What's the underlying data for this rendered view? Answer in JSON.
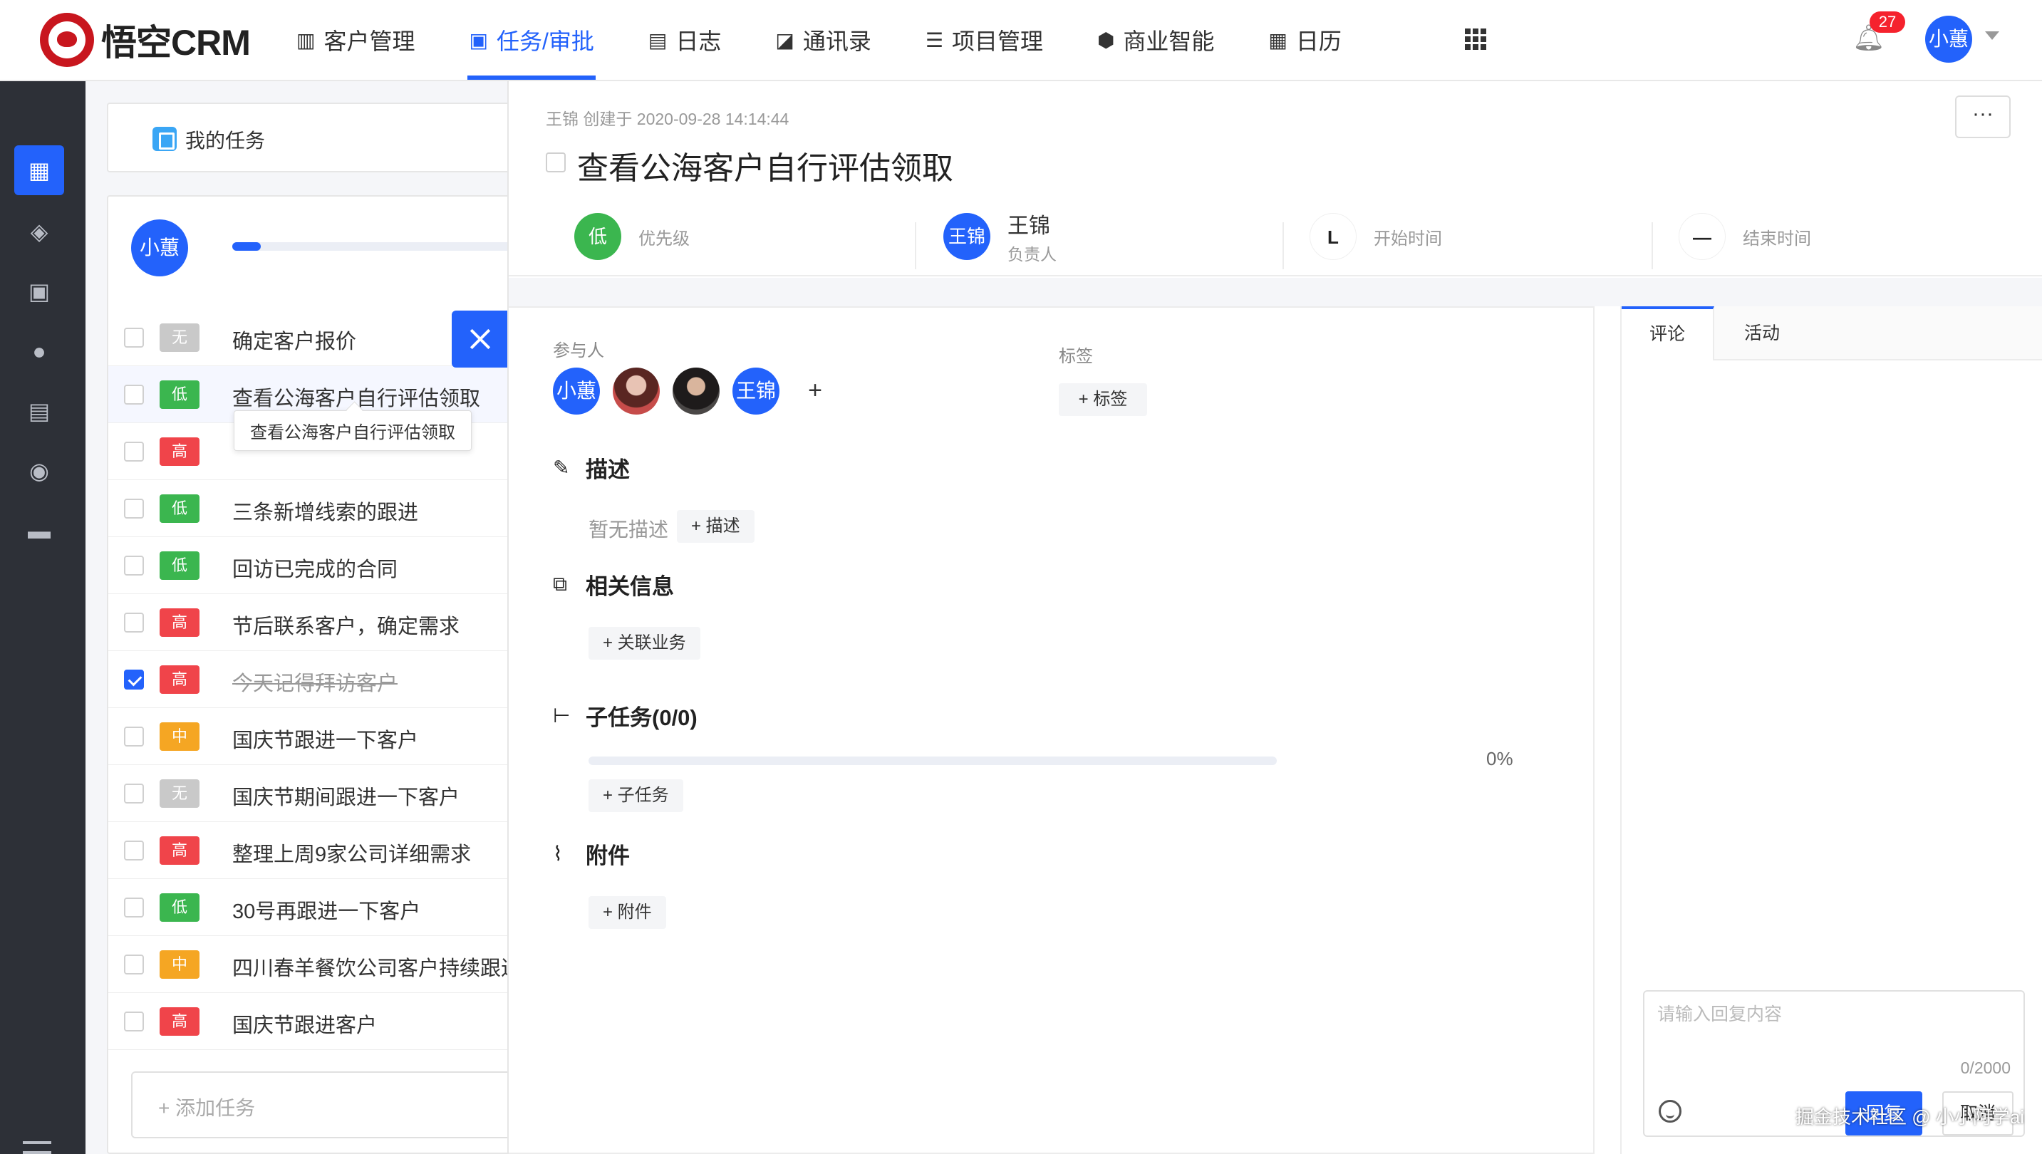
{
  "app": {
    "logo_text": "悟空CRM"
  },
  "nav": [
    {
      "label": "客户管理",
      "icon": "building-icon"
    },
    {
      "label": "任务/审批",
      "icon": "briefcase-icon"
    },
    {
      "label": "日志",
      "icon": "journal-icon"
    },
    {
      "label": "通讯录",
      "icon": "address-book-icon"
    },
    {
      "label": "项目管理",
      "icon": "list-icon"
    },
    {
      "label": "商业智能",
      "icon": "shield-check-icon"
    },
    {
      "label": "日历",
      "icon": "calendar-icon"
    }
  ],
  "header": {
    "notification_count": "27",
    "user_avatar": "小蕙"
  },
  "colors": {
    "accent": "#2362fb",
    "prio_low": "#3bb64f",
    "prio_high": "#f0444a",
    "prio_mid": "#f5a623",
    "prio_none": "#c9c9c9"
  },
  "task_panel": {
    "my_tasks_label": "我的任务",
    "avatar": "小蕙",
    "progress": 0.08,
    "add_task_placeholder": "+  添加任务",
    "tooltip": "查看公海客户自行评估领取",
    "tasks": [
      {
        "priority": "无",
        "name": "确定客户报价",
        "done": false
      },
      {
        "priority": "低",
        "name": "查看公海客户自行评估领取",
        "done": false
      },
      {
        "priority": "高",
        "name": "",
        "done": false
      },
      {
        "priority": "低",
        "name": "三条新增线索的跟进",
        "done": false
      },
      {
        "priority": "低",
        "name": "回访已完成的合同",
        "done": false
      },
      {
        "priority": "高",
        "name": "节后联系客户，确定需求",
        "done": false
      },
      {
        "priority": "高",
        "name": "今天记得拜访客户",
        "done": true
      },
      {
        "priority": "中",
        "name": "国庆节跟进一下客户",
        "done": false
      },
      {
        "priority": "无",
        "name": "国庆节期间跟进一下客户",
        "done": false
      },
      {
        "priority": "高",
        "name": "整理上周9家公司详细需求",
        "done": false
      },
      {
        "priority": "低",
        "name": "30号再跟进一下客户",
        "done": false
      },
      {
        "priority": "中",
        "name": "四川春羊餐饮公司客户持续跟进",
        "done": false
      },
      {
        "priority": "高",
        "name": "国庆节跟进客户",
        "done": false
      }
    ]
  },
  "detail": {
    "creator": "王锦 创建于 2020-09-28 14:14:44",
    "more_label": "···",
    "title": "查看公海客户自行评估领取",
    "priority_value": "低",
    "priority_label": "优先级",
    "owner_avatar": "王锦",
    "owner_name": "王锦",
    "owner_label": "负责人",
    "start_icon_text": "L",
    "start_label": "开始时间",
    "end_icon_text": "—",
    "end_label": "结束时间",
    "participants_label": "参与人",
    "participants": [
      {
        "text": "小蕙"
      },
      {
        "text": ""
      },
      {
        "text": ""
      },
      {
        "text": "王锦"
      }
    ],
    "tags_label": "标签",
    "add_tag": "+ 标签",
    "description_heading": "描述",
    "no_description": "暂无描述",
    "add_description": "+ 描述",
    "related_heading": "相关信息",
    "add_related": "+ 关联业务",
    "subtasks_heading": "子任务(0/0)",
    "subtask_progress": "0%",
    "add_subtask": "+ 子任务",
    "attachments_heading": "附件",
    "add_attachment": "+ 附件"
  },
  "comments": {
    "tabs": [
      "评论",
      "活动"
    ],
    "placeholder": "请输入回复内容",
    "char_count": "0/2000",
    "reply_button": "回复",
    "cancel_button": "取消"
  },
  "watermark": "掘金技术社区 @ 小小阿学ai"
}
